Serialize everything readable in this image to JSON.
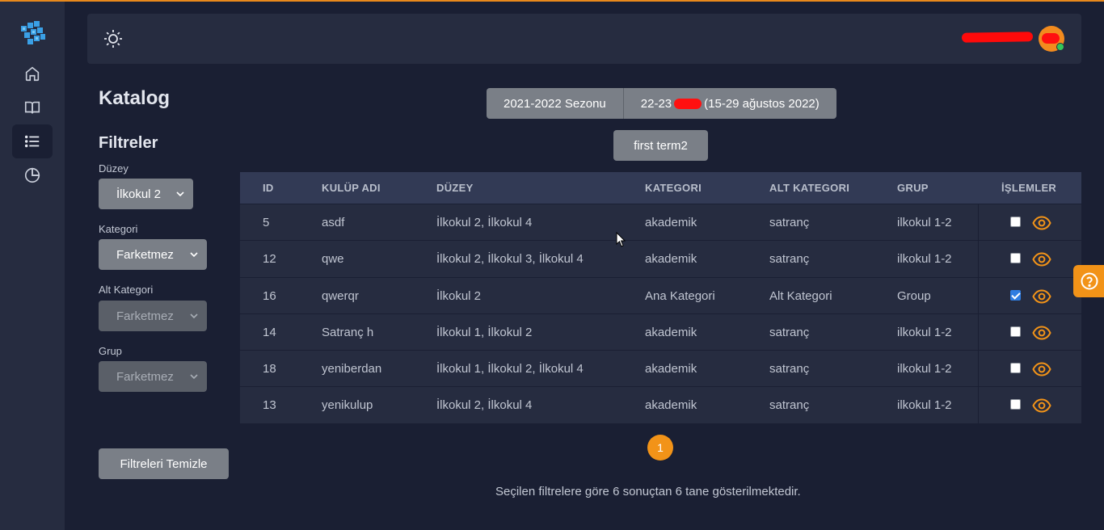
{
  "sidebar": {
    "logo_icon": "cube-logo-icon",
    "items": [
      {
        "icon": "home-icon",
        "active": false
      },
      {
        "icon": "book-icon",
        "active": false
      },
      {
        "icon": "list-icon",
        "active": true
      },
      {
        "icon": "pie-chart-icon",
        "active": false
      }
    ]
  },
  "topbar": {
    "theme_icon": "sun-icon",
    "avatar_status_color": "#34c759"
  },
  "page": {
    "title": "Katalog",
    "filters_title": "Filtreler"
  },
  "filters": {
    "level": {
      "label": "Düzey",
      "value": "İlkokul 2",
      "disabled": false
    },
    "category": {
      "label": "Kategori",
      "value": "Farketmez",
      "disabled": false
    },
    "subcategory": {
      "label": "Alt Kategori",
      "value": "Farketmez",
      "disabled": true
    },
    "group": {
      "label": "Grup",
      "value": "Farketmez",
      "disabled": true
    },
    "clear_label": "Filtreleri Temizle"
  },
  "season": {
    "season_label": "2021-2022 Sezonu",
    "period_prefix": "22-23",
    "period_suffix": "(15-29 ağustos 2022)",
    "term_label": "first term2"
  },
  "table": {
    "headers": {
      "id": "ID",
      "name": "KULÜP ADI",
      "level": "DÜZEY",
      "category": "KATEGORI",
      "subcategory": "ALT KATEGORI",
      "group": "GRUP",
      "actions": "İŞLEMLER"
    },
    "rows": [
      {
        "id": "5",
        "name": "asdf",
        "level": "İlkokul 2, İlkokul 4",
        "category": "akademik",
        "subcategory": "satranç",
        "group": "ilkokul 1-2",
        "checked": false
      },
      {
        "id": "12",
        "name": "qwe",
        "level": "İlkokul 2, İlkokul 3, İlkokul 4",
        "category": "akademik",
        "subcategory": "satranç",
        "group": "ilkokul 1-2",
        "checked": false
      },
      {
        "id": "16",
        "name": "qwerqr",
        "level": "İlkokul 2",
        "category": "Ana Kategori",
        "subcategory": "Alt Kategori",
        "group": "Group",
        "checked": true
      },
      {
        "id": "14",
        "name": "Satranç h",
        "level": "İlkokul 1, İlkokul 2",
        "category": "akademik",
        "subcategory": "satranç",
        "group": "ilkokul 1-2",
        "checked": false
      },
      {
        "id": "18",
        "name": "yeniberdan",
        "level": "İlkokul 1, İlkokul 2, İlkokul 4",
        "category": "akademik",
        "subcategory": "satranç",
        "group": "ilkokul 1-2",
        "checked": false
      },
      {
        "id": "13",
        "name": "yenikulup",
        "level": "İlkokul 2, İlkokul 4",
        "category": "akademik",
        "subcategory": "satranç",
        "group": "ilkokul 1-2",
        "checked": false
      }
    ]
  },
  "pagination": {
    "current": "1"
  },
  "result_text": "Seçilen filtrelere göre 6 sonuçtan 6 tane gösterilmektedir.",
  "help_icon": "question-circle-icon",
  "colors": {
    "accent": "#f29318",
    "background": "#1a1f33",
    "panel": "#262c40",
    "header": "#323a55",
    "button": "#7a7f87",
    "checked": "#2f7de1"
  }
}
